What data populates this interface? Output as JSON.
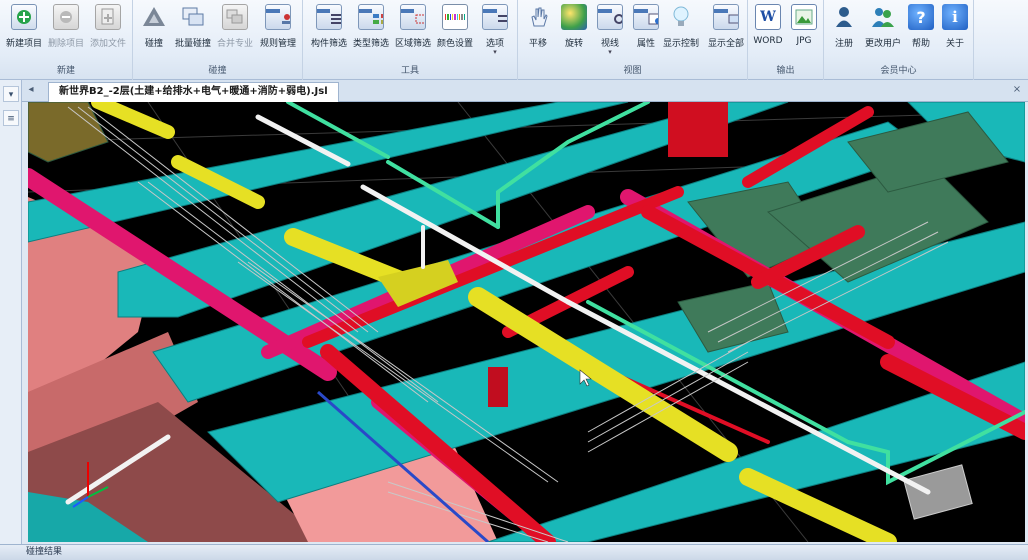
{
  "ribbon": {
    "groups": [
      {
        "label": "新建",
        "buttons": [
          "新建项目",
          "删除项目",
          "添加文件"
        ]
      },
      {
        "label": "碰撞",
        "buttons": [
          "碰撞",
          "批量碰撞",
          "合并专业",
          "规则管理"
        ]
      },
      {
        "label": "工具",
        "buttons": [
          "构件筛选",
          "类型筛选",
          "区域筛选",
          "颜色设置",
          "选项"
        ]
      },
      {
        "label": "视图",
        "buttons": [
          "平移",
          "旋转",
          "视线",
          "属性",
          "显示控制",
          "显示全部"
        ]
      },
      {
        "label": "输出",
        "buttons": [
          "WORD",
          "JPG"
        ]
      },
      {
        "label": "会员中心",
        "buttons": [
          "注册",
          "更改用户",
          "帮助",
          "关于"
        ]
      }
    ]
  },
  "document_tab": {
    "title": "新世界B2_-2层(土建+给排水+电气+暖通+消防+弱电).Jsl"
  },
  "status_bar": {
    "text": "碰撞结果"
  },
  "icons": {
    "new_project": "plus-icon",
    "delete_project": "delete-icon",
    "add_file": "add-file-icon",
    "collide": "triangle-icon",
    "help": "question-icon",
    "about": "info-icon"
  },
  "colors": {
    "beam": "#19b8b8",
    "pipe_yellow": "#e6e024",
    "pipe_red": "#e00e25",
    "pipe_magenta": "#e0166e",
    "pipe_green": "#40e0a0",
    "equipment_green": "#3f7a5a",
    "wall_salmon": "#e08080"
  }
}
